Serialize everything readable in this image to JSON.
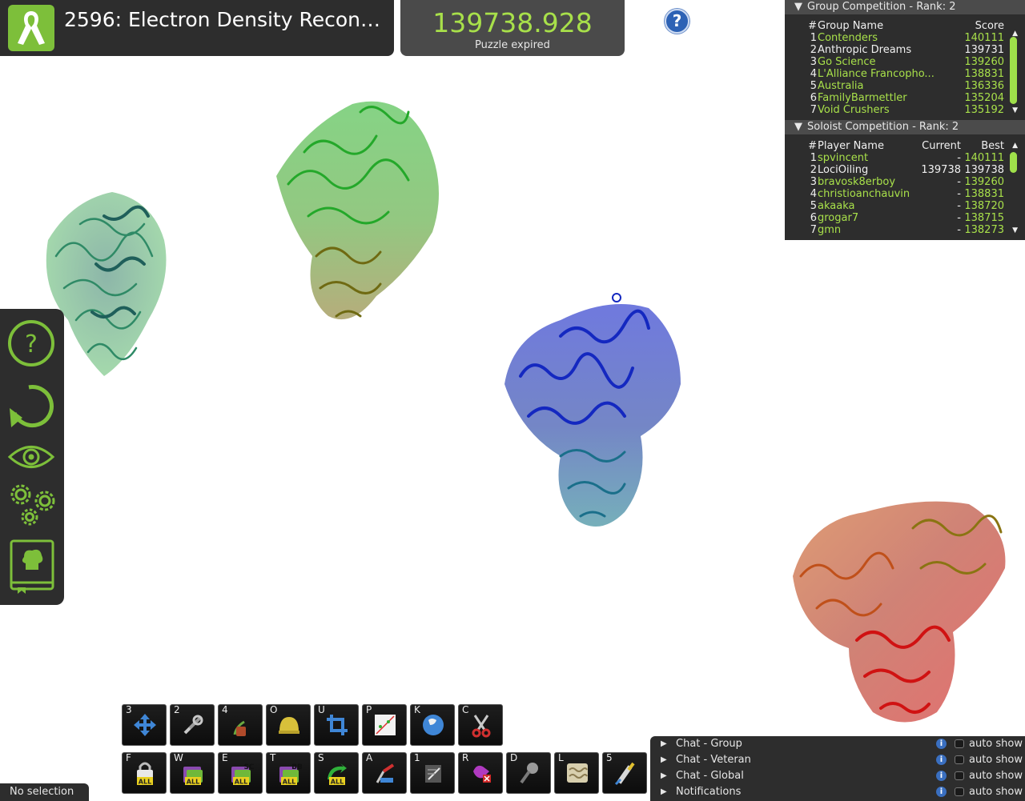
{
  "title_bar": {
    "puzzle_title": "2596: Electron Density Reconstr...",
    "ribbon_icon": "awareness-ribbon-icon"
  },
  "score_panel": {
    "score": "139738.928",
    "status": "Puzzle expired"
  },
  "help_button": {
    "label": "?"
  },
  "group_competition": {
    "header": "Group Competition  -  Rank: 2",
    "columns": {
      "rank": "#",
      "name": "Group Name",
      "score": "Score"
    },
    "rows": [
      {
        "rank": "1",
        "name": "Contenders",
        "score": "140111",
        "highlight": true
      },
      {
        "rank": "2",
        "name": "Anthropic Dreams",
        "score": "139731",
        "highlight": false
      },
      {
        "rank": "3",
        "name": "Go Science",
        "score": "139260",
        "highlight": true
      },
      {
        "rank": "4",
        "name": "L'Alliance Francopho...",
        "score": "138831",
        "highlight": true
      },
      {
        "rank": "5",
        "name": "Australia",
        "score": "136336",
        "highlight": true
      },
      {
        "rank": "6",
        "name": "FamilyBarmettler",
        "score": "135204",
        "highlight": true
      },
      {
        "rank": "7",
        "name": "Void Crushers",
        "score": "135192",
        "highlight": true
      }
    ]
  },
  "soloist_competition": {
    "header": "Soloist Competition  -  Rank: 2",
    "columns": {
      "rank": "#",
      "name": "Player Name",
      "current": "Current",
      "best": "Best"
    },
    "rows": [
      {
        "rank": "1",
        "name": "spvincent",
        "current": "-",
        "best": "140111",
        "highlight": true
      },
      {
        "rank": "2",
        "name": "LociOiling",
        "current": "139738",
        "best": "139738",
        "highlight": false
      },
      {
        "rank": "3",
        "name": "bravosk8erboy",
        "current": "-",
        "best": "139260",
        "highlight": true
      },
      {
        "rank": "4",
        "name": "christioanchauvin",
        "current": "-",
        "best": "138831",
        "highlight": true
      },
      {
        "rank": "5",
        "name": "akaaka",
        "current": "-",
        "best": "138720",
        "highlight": true
      },
      {
        "rank": "6",
        "name": "grogar7",
        "current": "-",
        "best": "138715",
        "highlight": true
      },
      {
        "rank": "7",
        "name": "gmn",
        "current": "-",
        "best": "138273",
        "highlight": true
      }
    ]
  },
  "left_panel": {
    "buttons": [
      {
        "name": "help-icon"
      },
      {
        "name": "undo-icon"
      },
      {
        "name": "view-eye-icon"
      },
      {
        "name": "settings-gears-icon"
      },
      {
        "name": "cookbook-icon"
      }
    ]
  },
  "toolbar": {
    "row1": [
      {
        "key": "3",
        "icon": "move-arrows-icon"
      },
      {
        "key": "2",
        "icon": "tools-icon"
      },
      {
        "key": "4",
        "icon": "wiggle-tweezers-icon"
      },
      {
        "key": "O",
        "icon": "helmet-icon"
      },
      {
        "key": "U",
        "icon": "crop-icon"
      },
      {
        "key": "P",
        "icon": "contact-map-icon"
      },
      {
        "key": "K",
        "icon": "globe-icon"
      },
      {
        "key": "C",
        "icon": "scissors-icon"
      }
    ],
    "row2": [
      {
        "key": "F",
        "icon": "freeze-all-icon",
        "badge": "ALL",
        "sub": ""
      },
      {
        "key": "W",
        "icon": "wiggle-all-icon",
        "badge": "ALL",
        "sub": ""
      },
      {
        "key": "E",
        "icon": "wiggle-sidechains-icon",
        "badge": "ALL",
        "sub": "SC"
      },
      {
        "key": "T",
        "icon": "wiggle-backbone-icon",
        "badge": "ALL",
        "sub": "BB"
      },
      {
        "key": "S",
        "icon": "shake-all-icon",
        "badge": "ALL",
        "sub": ""
      },
      {
        "key": "A",
        "icon": "rebuild-icon",
        "badge": "",
        "sub": ""
      },
      {
        "key": "1",
        "icon": "notes-icon",
        "badge": "",
        "sub": ""
      },
      {
        "key": "R",
        "icon": "remove-bands-icon",
        "badge": "",
        "sub": ""
      },
      {
        "key": "D",
        "icon": "mutate-icon",
        "badge": "",
        "sub": ""
      },
      {
        "key": "L",
        "icon": "density-map-icon",
        "badge": "",
        "sub": ""
      },
      {
        "key": "5",
        "icon": "sidechain-tube-icon",
        "badge": "",
        "sub": ""
      }
    ]
  },
  "status": {
    "selection": "No selection"
  },
  "chat": {
    "rows": [
      {
        "label": "Chat - Group",
        "auto": "auto show"
      },
      {
        "label": "Chat - Veteran",
        "auto": "auto show"
      },
      {
        "label": "Chat - Global",
        "auto": "auto show"
      },
      {
        "label": "Notifications",
        "auto": "auto show"
      }
    ],
    "info_glyph": "i"
  },
  "colors": {
    "accent_green": "#a8e04a",
    "panel_dark": "#2d2d2d",
    "protein_blue": "#1830b0",
    "protein_green": "#3aa030",
    "protein_red": "#c81818"
  }
}
